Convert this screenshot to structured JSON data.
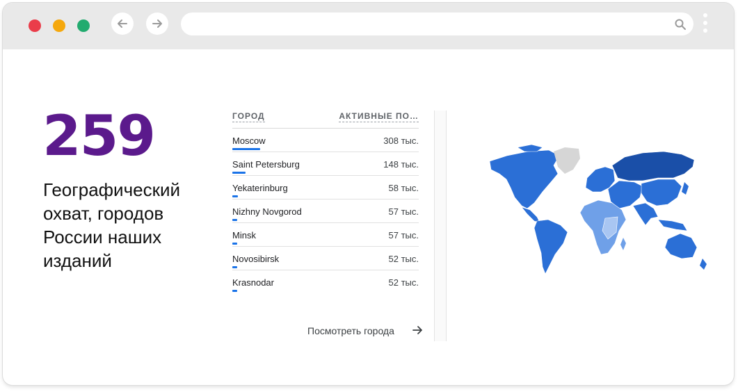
{
  "browser": {
    "dots": [
      "#ea3d4a",
      "#f5a80d",
      "#22ab6f"
    ],
    "url": ""
  },
  "stat": {
    "number": "259",
    "caption": "Географический охват, городов России наших изданий"
  },
  "table": {
    "headers": {
      "city": "ГОРОД",
      "users": "АКТИВНЫЕ ПО…"
    },
    "rows": [
      {
        "city": "Moscow",
        "value": "308 тыс.",
        "share": 1.0
      },
      {
        "city": "Saint Petersburg",
        "value": "148 тыс.",
        "share": 0.48
      },
      {
        "city": "Yekaterinburg",
        "value": "58 тыс.",
        "share": 0.19
      },
      {
        "city": "Nizhny Novgorod",
        "value": "57 тыс.",
        "share": 0.185
      },
      {
        "city": "Minsk",
        "value": "57 тыс.",
        "share": 0.185
      },
      {
        "city": "Novosibirsk",
        "value": "52 тыс.",
        "share": 0.17
      },
      {
        "city": "Krasnodar",
        "value": "52 тыс.",
        "share": 0.17
      }
    ],
    "bar_color": "#1a73e8"
  },
  "link": {
    "label": "Посмотреть города"
  },
  "map": {
    "colors": {
      "dark": "#1a4fa8",
      "mid": "#2b6fd6",
      "light": "#6fa0e8",
      "pale": "#a9c6f2",
      "gray": "#d6d6d6"
    }
  }
}
